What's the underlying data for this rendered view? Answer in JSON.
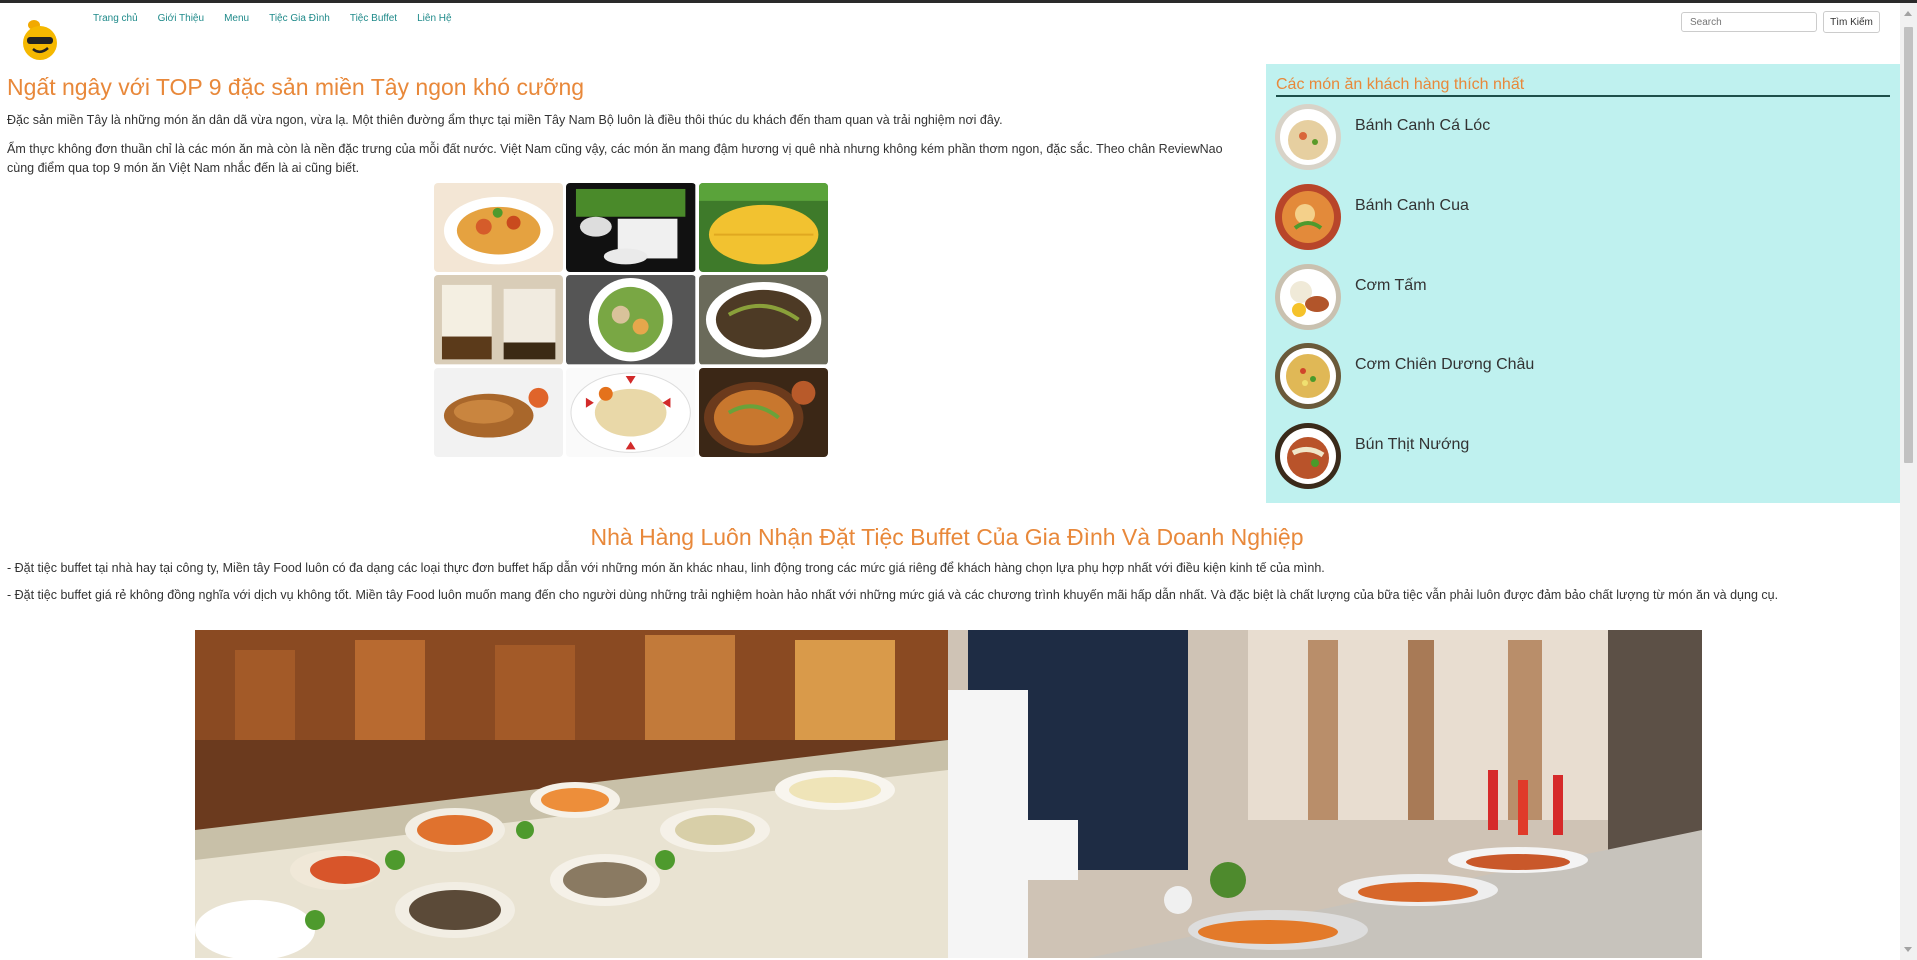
{
  "nav": {
    "links": [
      "Trang chủ",
      "Giới Thiệu",
      "Menu",
      "Tiệc Gia Đình",
      "Tiệc Buffet",
      "Liên Hệ"
    ],
    "search_placeholder": "Search",
    "search_button": "Tìm Kiếm"
  },
  "article": {
    "title": "Ngất ngây với TOP 9 đặc sản miền Tây ngon khó cưỡng",
    "p1": "Đặc sản miền Tây là những món ăn dân dã vừa ngon, vừa lạ. Một thiên đường ẩm thực tại miền Tây Nam Bộ luôn là điều thôi thúc du khách đến tham quan và trải nghiệm nơi đây.",
    "p2": "Ẩm thực không đơn thuần chỉ là các món ăn mà còn là nền đặc trưng của mỗi đất nước. Việt Nam cũng vậy, các món ăn mang đậm hương vị quê nhà nhưng không kém phần thơm ngon, đặc sắc. Theo chân ReviewNao cùng điểm qua top 9 món ăn Việt Nam nhắc đến là ai cũng biết."
  },
  "sidebar": {
    "title": "Các món ăn khách hàng thích nhất",
    "dishes": [
      "Bánh Canh Cá Lóc",
      "Bánh Canh Cua",
      "Cơm Tấm",
      "Cơm Chiên Dương Châu",
      "Bún Thịt Nướng"
    ]
  },
  "section2": {
    "title": "Nhà Hàng Luôn Nhận Đặt Tiệc Buffet Của Gia Đình Và Doanh Nghiệp",
    "p1": "- Đặt tiệc buffet tại nhà hay tại công ty, Miền tây Food luôn có đa dạng các loại thực đơn buffet hấp dẫn với những món ăn khác nhau, linh động trong các mức giá riêng để khách hàng chọn lựa phụ hợp nhất với điều kiện kinh tế của mình.",
    "p2": "- Đặt tiệc buffet giá rẻ không đồng nghĩa với dịch vụ không tốt. Miền tây Food luôn muốn mang đến cho người dùng những trải nghiệm hoàn hảo nhất với những mức giá và các chương trình khuyến mãi hấp dẫn nhất. Và đặc biệt là chất lượng của bữa tiệc vẫn phải luôn được đảm bảo chất lượng từ món ăn và dụng cụ."
  },
  "colors": {
    "accent": "#e8883a",
    "nav_link": "#1f8a8a",
    "sidebar_bg": "#bff1ef",
    "sidebar_rule": "#1d4f4a"
  },
  "images": {
    "grid": [
      "food-photo",
      "food-photo",
      "food-photo",
      "food-photo",
      "food-photo",
      "food-photo",
      "food-photo",
      "food-photo",
      "food-photo"
    ],
    "buffet": [
      "buffet-hall-photo",
      "buffet-service-photo"
    ]
  }
}
